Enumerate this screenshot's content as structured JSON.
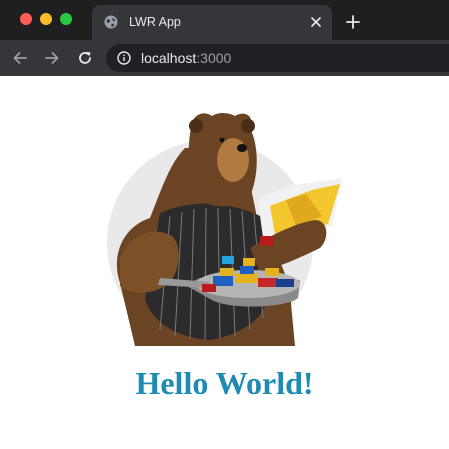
{
  "browser": {
    "tab": {
      "title": "LWR App",
      "favicon": "globe-icon"
    },
    "toolbar": {
      "back_icon": "arrow-left-icon",
      "forward_icon": "arrow-right-icon",
      "reload_icon": "reload-icon",
      "site_info_icon": "info-icon"
    },
    "address_bar": {
      "host": "localhost",
      "port": ":3000"
    },
    "colors": {
      "frame": "#1f1f1f",
      "toolbar": "#35363a",
      "omnibox": "#202124",
      "close_light": "#ff5f57",
      "minimize_light": "#febc2e",
      "maximize_light": "#28c840"
    }
  },
  "page": {
    "heading": "Hello World!",
    "heading_color": "#1f8bb3",
    "illustration": "bear-reading-recipe-book-icon"
  }
}
